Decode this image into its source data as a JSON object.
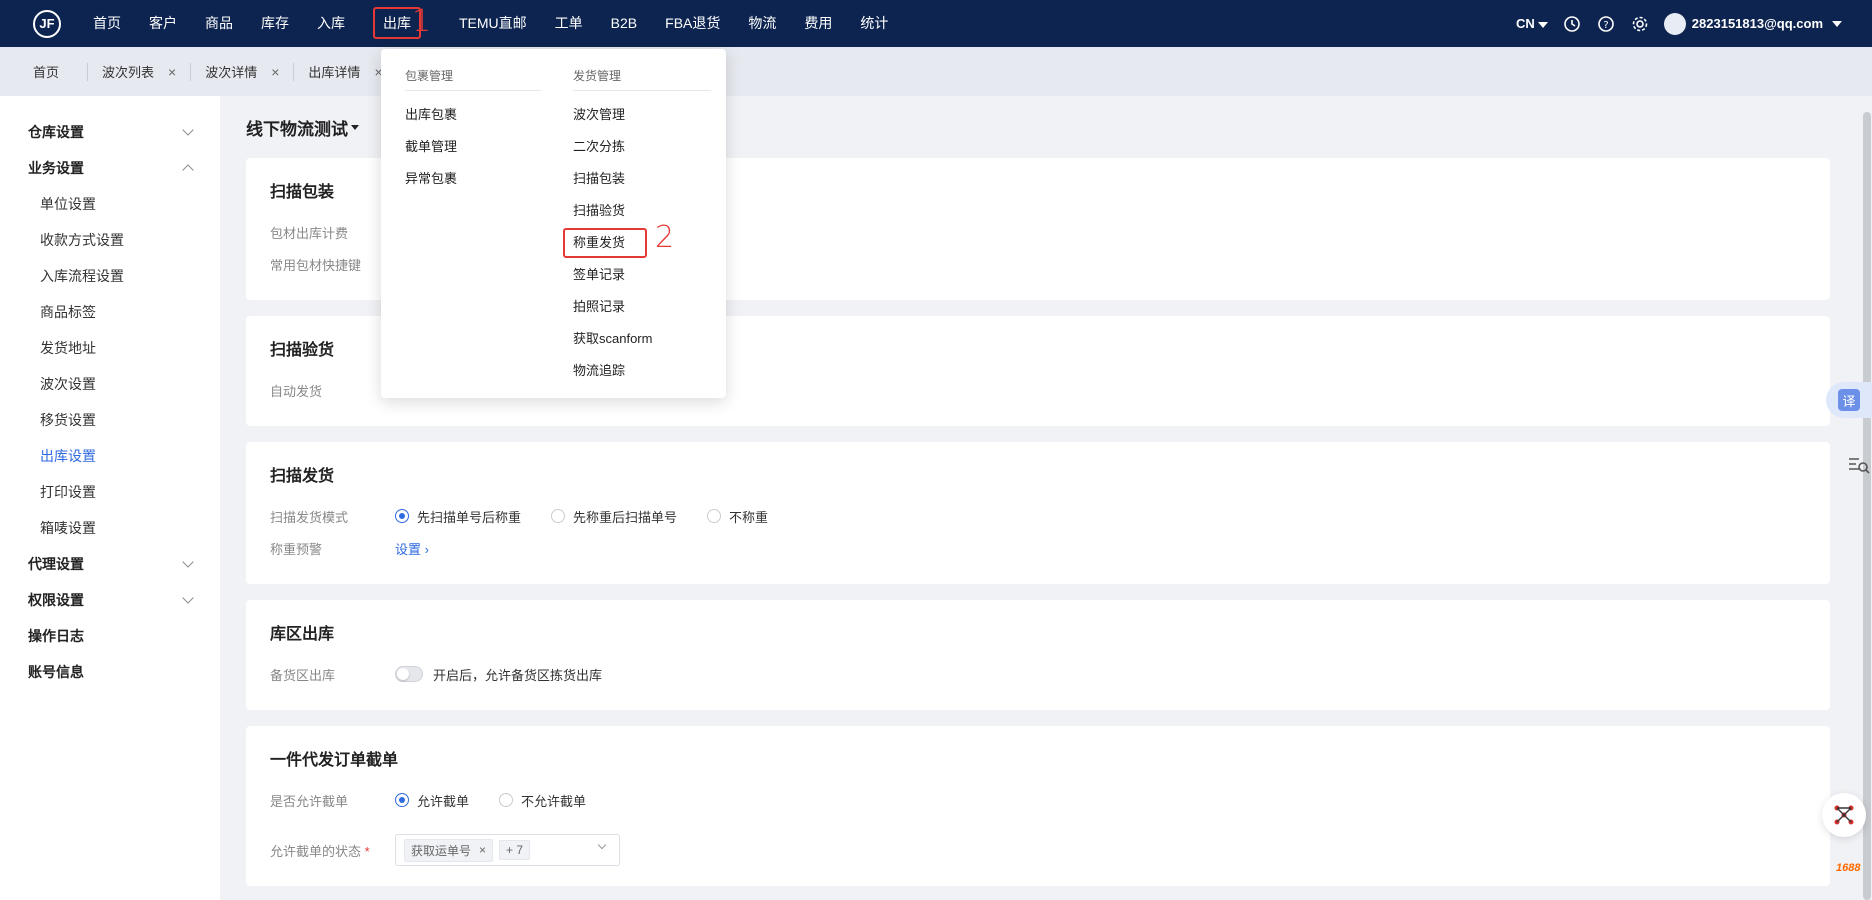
{
  "topbar": {
    "logo_text": "JF",
    "nav": [
      "首页",
      "客户",
      "商品",
      "库存",
      "入库",
      "出库",
      "TEMU直邮",
      "工单",
      "B2B",
      "FBA退货",
      "物流",
      "费用",
      "统计"
    ],
    "active_nav": "出库",
    "lang": "CN",
    "user": "2823151813@qq.com"
  },
  "annotations": {
    "step1": "1",
    "step2": "2"
  },
  "tabs": [
    {
      "label": "首页"
    },
    {
      "label": "波次列表",
      "close": "×"
    },
    {
      "label": "波次详情",
      "close": "×"
    },
    {
      "label": "出库详情",
      "close": "×"
    }
  ],
  "sidebar": {
    "groups": [
      {
        "label": "仓库设置"
      },
      {
        "label": "业务设置"
      },
      {
        "label": "代理设置"
      },
      {
        "label": "权限设置"
      },
      {
        "label": "操作日志"
      },
      {
        "label": "账号信息"
      }
    ],
    "items": [
      "单位设置",
      "收款方式设置",
      "入库流程设置",
      "商品标签",
      "发货地址",
      "波次设置",
      "移货设置",
      "出库设置",
      "打印设置",
      "箱唛设置"
    ],
    "active_item": "出库设置"
  },
  "main": {
    "header": "线下物流测试",
    "cards": {
      "scan_pack": {
        "title": "扫描包装",
        "rows": [
          "包材出库计费",
          "常用包材快捷键"
        ]
      },
      "scan_check": {
        "title": "扫描验货",
        "rows": [
          "自动发货"
        ]
      },
      "scan_ship": {
        "title": "扫描发货",
        "mode_label": "扫描发货模式",
        "options": [
          "先扫描单号后称重",
          "先称重后扫描单号",
          "不称重"
        ],
        "selected": "先扫描单号后称重",
        "warn_label": "称重预警",
        "warn_link": "设置 ›"
      },
      "zone_out": {
        "title": "库区出库",
        "label": "备货区出库",
        "toggle_text": "开启后，允许备货区拣货出库"
      },
      "dropship": {
        "title": "一件代发订单截单",
        "allow_label": "是否允许截单",
        "allow_options": [
          "允许截单",
          "不允许截单"
        ],
        "allow_selected": "允许截单",
        "status_label": "允许截单的状态",
        "required_mark": "*",
        "status_tag": "获取运单号",
        "status_tag_close": "×",
        "status_more": "+ 7"
      }
    }
  },
  "dropdown": {
    "col1": {
      "header": "包裹管理",
      "items": [
        "出库包裹",
        "截单管理",
        "异常包裹"
      ]
    },
    "col2": {
      "header": "发货管理",
      "items": [
        "波次管理",
        "二次分拣",
        "扫描包装",
        "扫描验货",
        "称重发货",
        "签单记录",
        "拍照记录",
        "获取scanform",
        "物流追踪"
      ],
      "highlighted": "称重发货"
    }
  },
  "floating": {
    "translate": "译",
    "brand": "1688"
  }
}
